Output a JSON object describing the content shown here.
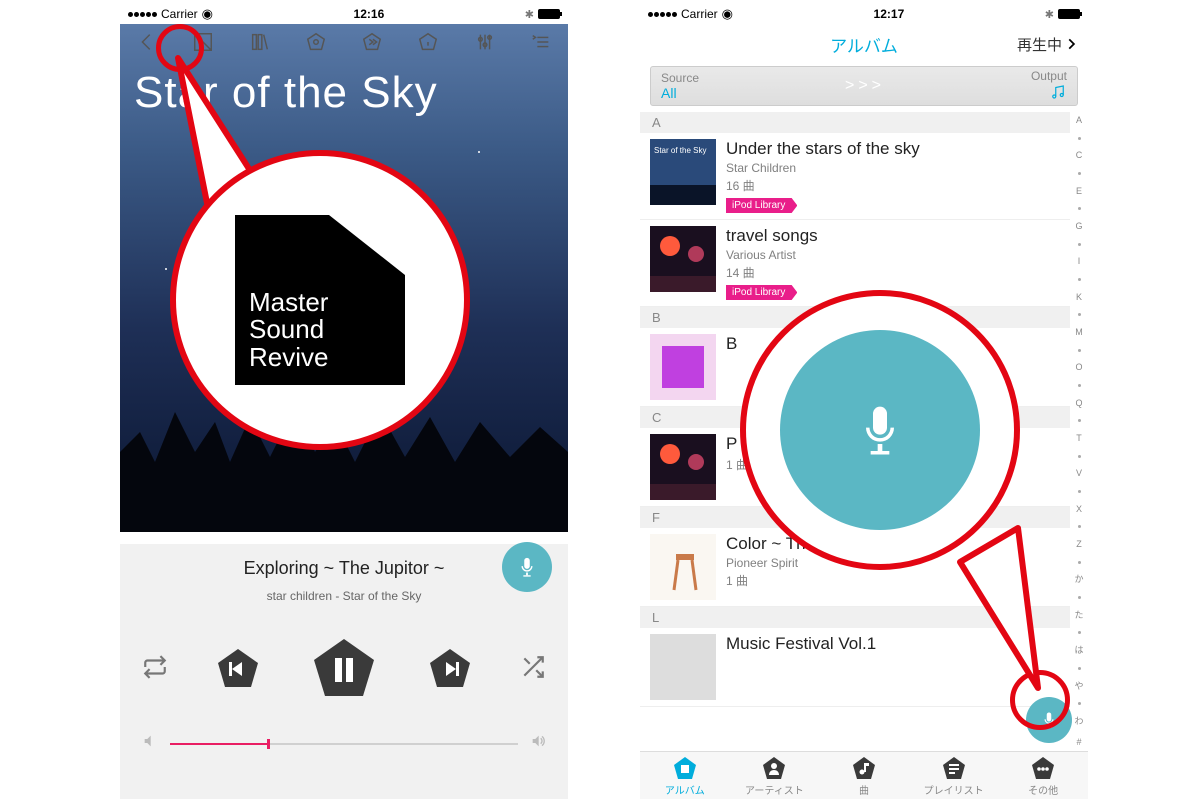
{
  "left": {
    "status": {
      "carrier": "Carrier",
      "time": "12:16"
    },
    "album_title": "Star of the Sky",
    "track": "Exploring ~ The Jupitor ~",
    "subtitle": "star children - Star of the Sky",
    "msr_logo": {
      "l1": "Master",
      "l2": "Sound",
      "l3": "Revive"
    }
  },
  "right": {
    "status": {
      "carrier": "Carrier",
      "time": "12:17"
    },
    "header": "アルバム",
    "now_playing": "再生中",
    "source_label": "Source",
    "source_value": "All",
    "arrow": ">>>",
    "output_label": "Output",
    "sections": [
      {
        "letter": "A",
        "rows": [
          {
            "title": "Under the stars of the sky",
            "artist": "Star Children",
            "count": "16 曲",
            "tag": "iPod Library",
            "thumb": "sky"
          },
          {
            "title": "travel songs",
            "artist": "Various Artist",
            "count": "14 曲",
            "tag": "iPod Library",
            "thumb": "stage"
          }
        ]
      },
      {
        "letter": "B",
        "rows": [
          {
            "title": "B",
            "artist": "",
            "count": "",
            "tag": "",
            "thumb": "purple"
          }
        ]
      },
      {
        "letter": "C",
        "rows": [
          {
            "title": "P",
            "artist": "",
            "count": "1 曲",
            "tag": "",
            "thumb": "stage2"
          }
        ]
      },
      {
        "letter": "F",
        "rows": [
          {
            "title": "Color ~ The Mars ~",
            "artist": "Pioneer Spirit",
            "count": "1 曲",
            "tag": "",
            "thumb": "stool"
          }
        ]
      },
      {
        "letter": "L",
        "rows": [
          {
            "title": "Music Festival Vol.1",
            "artist": "",
            "count": "",
            "tag": "",
            "thumb": "none"
          }
        ]
      }
    ],
    "index": [
      "A",
      "●",
      "C",
      "●",
      "E",
      "●",
      "G",
      "●",
      "I",
      "●",
      "K",
      "●",
      "M",
      "●",
      "O",
      "●",
      "Q",
      "●",
      "T",
      "●",
      "V",
      "●",
      "X",
      "●",
      "Z",
      "●",
      "か",
      "●",
      "た",
      "●",
      "は",
      "●",
      "や",
      "●",
      "わ",
      "#"
    ],
    "tabs": [
      {
        "label": "アルバム",
        "active": true
      },
      {
        "label": "アーティスト"
      },
      {
        "label": "曲"
      },
      {
        "label": "プレイリスト"
      },
      {
        "label": "その他"
      }
    ]
  }
}
